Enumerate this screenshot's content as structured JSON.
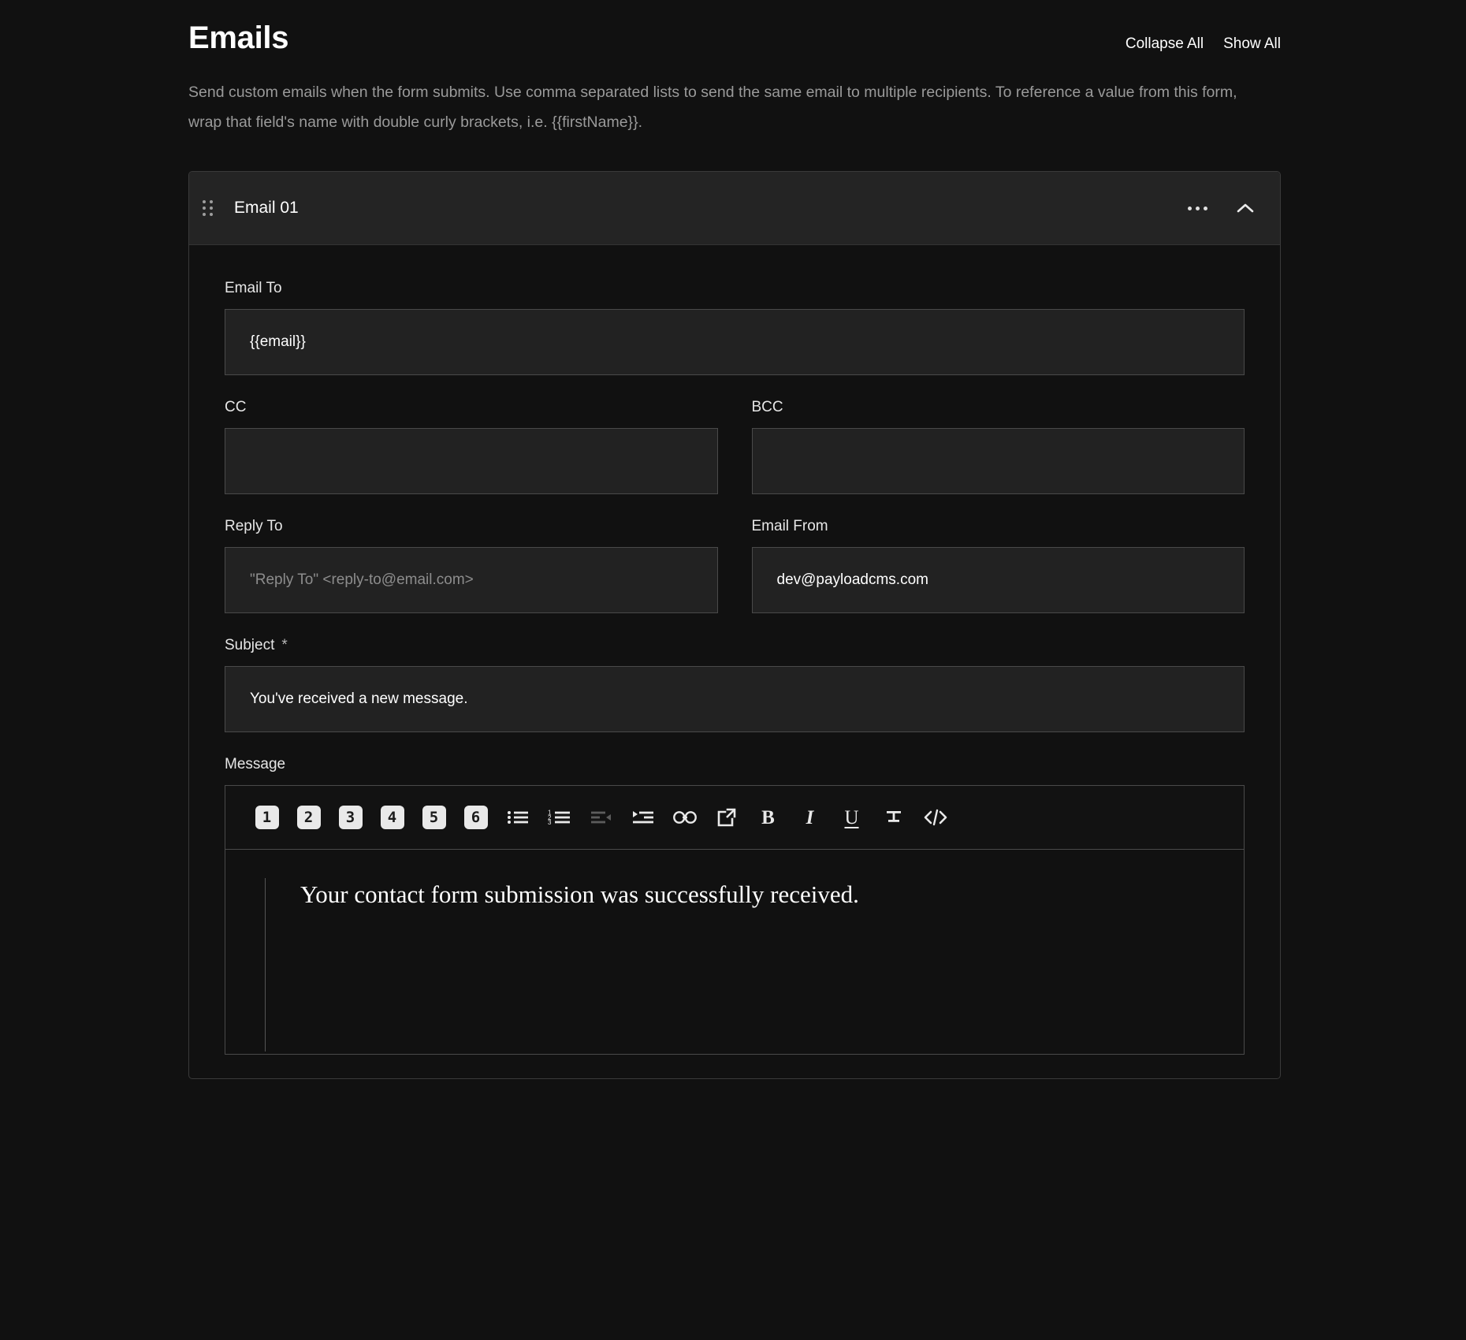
{
  "page": {
    "title": "Emails",
    "description": "Send custom emails when the form submits. Use comma separated lists to send the same email to multiple recipients. To reference a value from this form, wrap that field's name with double curly brackets, i.e. {{firstName}}.",
    "actions": {
      "collapse_all": "Collapse All",
      "show_all": "Show All"
    }
  },
  "email_block": {
    "title": "Email 01",
    "drag_handle_icon": "drag-dots-icon",
    "more_icon": "ellipsis-icon",
    "collapse_icon": "chevron-up-icon",
    "fields": {
      "email_to": {
        "label": "Email To",
        "value": "{{email}}",
        "placeholder": ""
      },
      "cc": {
        "label": "CC",
        "value": "",
        "placeholder": ""
      },
      "bcc": {
        "label": "BCC",
        "value": "",
        "placeholder": ""
      },
      "reply_to": {
        "label": "Reply To",
        "value": "",
        "placeholder": "\"Reply To\" <reply-to@email.com>"
      },
      "email_from": {
        "label": "Email From",
        "value": "dev@payloadcms.com",
        "placeholder": ""
      },
      "subject": {
        "label": "Subject",
        "required_marker": "*",
        "value": "You've received a new message.",
        "placeholder": ""
      },
      "message": {
        "label": "Message",
        "content": "Your contact form submission was successfully received."
      }
    }
  },
  "toolbar": {
    "headings": [
      {
        "label": "1",
        "name": "heading-1-button"
      },
      {
        "label": "2",
        "name": "heading-2-button"
      },
      {
        "label": "3",
        "name": "heading-3-button"
      },
      {
        "label": "4",
        "name": "heading-4-button"
      },
      {
        "label": "5",
        "name": "heading-5-button"
      },
      {
        "label": "6",
        "name": "heading-6-button"
      }
    ],
    "icons": [
      "bullet-list-icon",
      "numbered-list-icon",
      "outdent-icon",
      "indent-icon",
      "link-icon",
      "external-link-icon",
      "bold-icon",
      "italic-icon",
      "underline-icon",
      "strikethrough-icon",
      "code-icon"
    ],
    "letters": {
      "bold": "B",
      "italic": "I",
      "underline": "U"
    }
  },
  "colors": {
    "background": "#111111",
    "card_header": "#242424",
    "input_background": "#222222",
    "border": "#4a4a4a",
    "text": "#ffffff",
    "muted_text": "#9a9a9a"
  }
}
